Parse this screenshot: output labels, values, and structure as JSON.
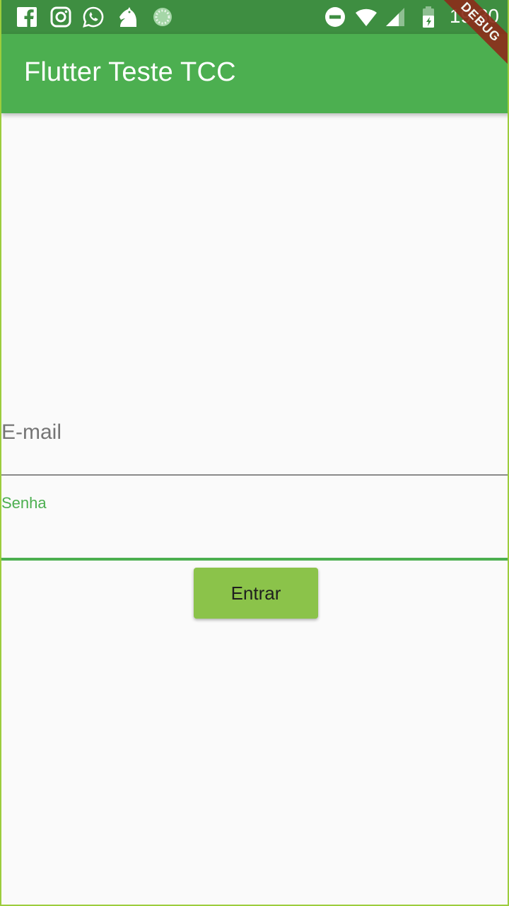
{
  "status_bar": {
    "time": "19:30",
    "left_icons": [
      "facebook-icon",
      "instagram-icon",
      "whatsapp-icon",
      "chess-knight-icon",
      "loading-icon"
    ],
    "right_icons": [
      "do-not-disturb-icon",
      "wifi-icon",
      "signal-icon",
      "battery-icon"
    ]
  },
  "app_bar": {
    "title": "Flutter Teste TCC"
  },
  "debug_banner": "DEBUG",
  "form": {
    "email_label": "E-mail",
    "senha_label": "Senha",
    "submit_label": "Entrar"
  },
  "colors": {
    "status_bar": "#3e8e41",
    "app_bar": "#4caf50",
    "button": "#8bc34a",
    "focus": "#4caf50",
    "background": "#fafafa"
  }
}
